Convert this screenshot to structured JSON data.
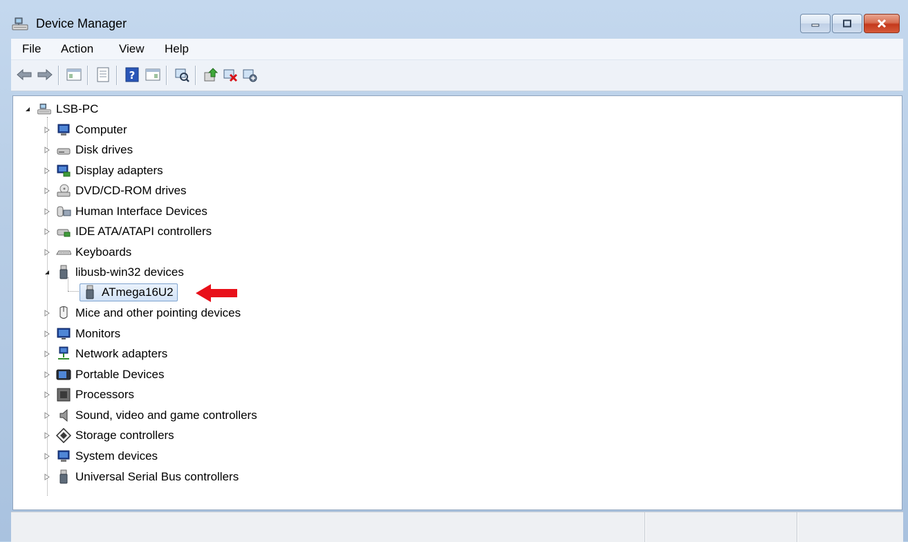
{
  "window": {
    "title": "Device Manager"
  },
  "menu": [
    "File",
    "Action",
    "View",
    "Help"
  ],
  "toolbar": {
    "buttons": [
      "back-icon",
      "forward-icon",
      "show-hide-tree-icon",
      "properties-icon",
      "help-icon",
      "action-pane-icon",
      "scan-hardware-icon",
      "update-driver-icon",
      "uninstall-icon",
      "disable-icon"
    ]
  },
  "tree": {
    "root": {
      "label": "LSB-PC",
      "icon": "computer-network-icon"
    },
    "categories": [
      {
        "label": "Computer",
        "icon": "computer-icon",
        "expanded": false
      },
      {
        "label": "Disk drives",
        "icon": "disk-drive-icon",
        "expanded": false
      },
      {
        "label": "Display adapters",
        "icon": "display-adapter-icon",
        "expanded": false
      },
      {
        "label": "DVD/CD-ROM drives",
        "icon": "dvd-icon",
        "expanded": false
      },
      {
        "label": "Human Interface Devices",
        "icon": "hid-icon",
        "expanded": false
      },
      {
        "label": "IDE ATA/ATAPI controllers",
        "icon": "ide-icon",
        "expanded": false
      },
      {
        "label": "Keyboards",
        "icon": "keyboard-icon",
        "expanded": false
      },
      {
        "label": "libusb-win32 devices",
        "icon": "usb-plug-icon",
        "expanded": true,
        "children": [
          {
            "label": "ATmega16U2",
            "icon": "usb-plug-icon",
            "selected": true
          }
        ]
      },
      {
        "label": "Mice and other pointing devices",
        "icon": "mouse-icon",
        "expanded": false
      },
      {
        "label": "Monitors",
        "icon": "monitor-icon",
        "expanded": false
      },
      {
        "label": "Network adapters",
        "icon": "network-icon",
        "expanded": false
      },
      {
        "label": "Portable Devices",
        "icon": "portable-device-icon",
        "expanded": false
      },
      {
        "label": "Processors",
        "icon": "processor-icon",
        "expanded": false
      },
      {
        "label": "Sound, video and game controllers",
        "icon": "speaker-icon",
        "expanded": false
      },
      {
        "label": "Storage controllers",
        "icon": "storage-icon",
        "expanded": false
      },
      {
        "label": "System devices",
        "icon": "system-icon",
        "expanded": false
      },
      {
        "label": "Universal Serial Bus controllers",
        "icon": "usb-plug-icon",
        "expanded": false
      }
    ]
  },
  "colors": {
    "annotation_arrow": "#e8101a",
    "selection": "#d3e3f7"
  }
}
